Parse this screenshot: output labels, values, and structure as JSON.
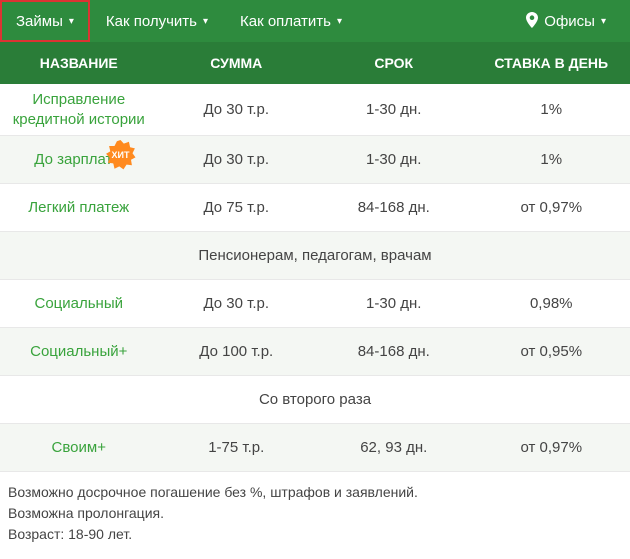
{
  "nav": {
    "items": [
      {
        "label": "Займы"
      },
      {
        "label": "Как получить"
      },
      {
        "label": "Как оплатить"
      }
    ],
    "offices": "Офисы"
  },
  "columns": {
    "name": "НАЗВАНИЕ",
    "sum": "СУММА",
    "term": "СРОК",
    "rate": "СТАВКА В ДЕНЬ"
  },
  "rows": [
    {
      "name_line1": "Исправление",
      "name_line2": "кредитной истории",
      "sum": "До 30 т.р.",
      "term": "1-30 дн.",
      "rate": "1%"
    },
    {
      "name_line1": "До зарплаты",
      "badge": "ХИТ",
      "sum": "До 30 т.р.",
      "term": "1-30 дн.",
      "rate": "1%"
    },
    {
      "name_line1": "Легкий платеж",
      "sum": "До 75 т.р.",
      "term": "84-168 дн.",
      "rate": "от 0,97%"
    }
  ],
  "group1": {
    "label": "Пенсионерам, педагогам, врачам"
  },
  "rows2": [
    {
      "name_line1": "Социальный",
      "sum": "До 30 т.р.",
      "term": "1-30 дн.",
      "rate": "0,98%"
    },
    {
      "name_line1": "Социальный+",
      "sum": "До 100 т.р.",
      "term": "84-168 дн.",
      "rate": "от 0,95%"
    }
  ],
  "group2": {
    "label": "Со второго раза"
  },
  "rows3": [
    {
      "name_line1": "Своим+",
      "sum": "1-75 т.р.",
      "term": "62, 93 дн.",
      "rate": "от 0,97%"
    }
  ],
  "footer": {
    "line1": "Возможно досрочное погашение без %, штрафов и заявлений.",
    "line2": "Возможна пролонгация.",
    "line3": "Возраст: 18-90 лет."
  }
}
